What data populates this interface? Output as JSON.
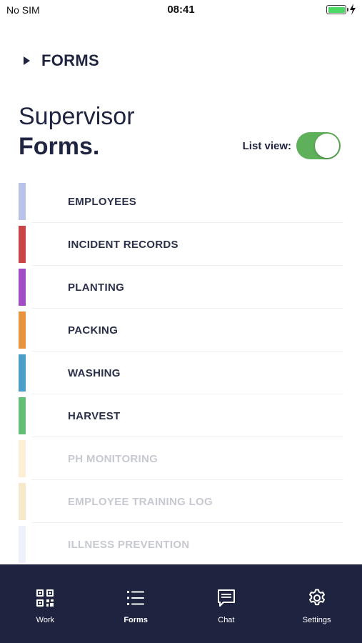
{
  "status_bar": {
    "carrier": "No SIM",
    "time": "08:41",
    "battery_color": "#4cd964"
  },
  "header": {
    "breadcrumb_icon": "caret-right-icon",
    "breadcrumb": "FORMS"
  },
  "title": {
    "line1": "Supervisor",
    "line2": "Forms."
  },
  "list_view": {
    "label": "List view:",
    "enabled": true,
    "color": "#5fb05a"
  },
  "forms": [
    {
      "label": "EMPLOYEES",
      "color": "#b9c3ea",
      "disabled": false
    },
    {
      "label": "INCIDENT RECORDS",
      "color": "#c94444",
      "disabled": false
    },
    {
      "label": "PLANTING",
      "color": "#a24dc4",
      "disabled": false
    },
    {
      "label": "PACKING",
      "color": "#e8933f",
      "disabled": false
    },
    {
      "label": "WASHING",
      "color": "#4c9ec9",
      "disabled": false
    },
    {
      "label": "HARVEST",
      "color": "#63be76",
      "disabled": false
    },
    {
      "label": "PH MONITORING",
      "color": "#fcefd6",
      "disabled": true
    },
    {
      "label": "EMPLOYEE TRAINING LOG",
      "color": "#f6e8cb",
      "disabled": true
    },
    {
      "label": "ILLNESS PREVENTION",
      "color": "#eef0fa",
      "disabled": true
    }
  ],
  "tabbar": {
    "background": "#1e2340",
    "tabs": [
      {
        "label": "Work",
        "icon": "qr-code-icon",
        "active": false
      },
      {
        "label": "Forms",
        "icon": "list-icon",
        "active": true
      },
      {
        "label": "Chat",
        "icon": "chat-bubble-icon",
        "active": false
      },
      {
        "label": "Settings",
        "icon": "gear-icon",
        "active": false
      }
    ]
  }
}
